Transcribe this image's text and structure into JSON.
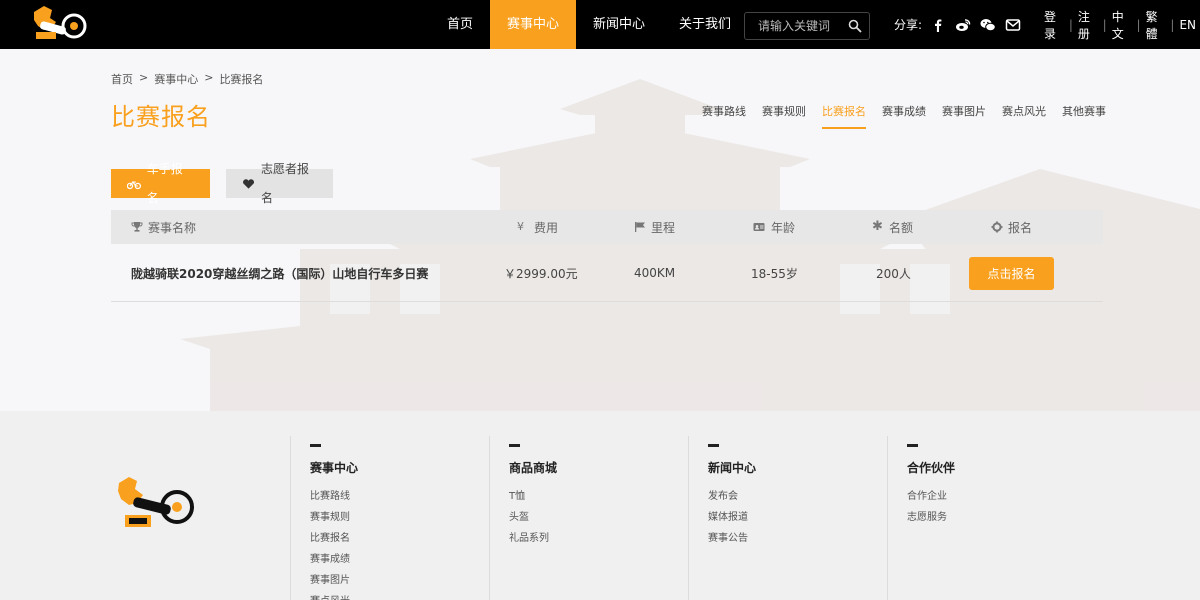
{
  "header": {
    "nav": [
      "首页",
      "赛事中心",
      "新闻中心",
      "关于我们"
    ],
    "nav_active": 1,
    "search_placeholder": "请输入关键词",
    "share_label": "分享:",
    "share_icons": [
      "facebook-icon",
      "weibo-icon",
      "wechat-icon",
      "email-icon"
    ],
    "links": [
      "登录",
      "注册",
      "中文",
      "繁體",
      "EN"
    ]
  },
  "breadcrumb": [
    "首页",
    ">",
    "赛事中心",
    ">",
    "比赛报名"
  ],
  "page_title": "比赛报名",
  "subnav": [
    "赛事路线",
    "赛事规则",
    "比赛报名",
    "赛事成绩",
    "赛事图片",
    "赛点风光",
    "其他赛事"
  ],
  "subnav_active": 2,
  "tabs": [
    {
      "label": "车手报名",
      "icon": "bicycle-icon"
    },
    {
      "label": "志愿者报名",
      "icon": "heart-icon"
    }
  ],
  "table": {
    "headers": [
      {
        "label": "赛事名称",
        "icon": "trophy-icon"
      },
      {
        "label": "费用",
        "icon": "yen-icon"
      },
      {
        "label": "里程",
        "icon": "flag-icon"
      },
      {
        "label": "年龄",
        "icon": "id-card-icon"
      },
      {
        "label": "名额",
        "icon": "asterisk-icon"
      },
      {
        "label": "报名",
        "icon": "gear-icon"
      }
    ],
    "rows": [
      {
        "name": "陇越骑联2020穿越丝绸之路（国际）山地自行车多日赛",
        "fee": "￥2999.00元",
        "distance": "400KM",
        "age": "18-55岁",
        "quota": "200人",
        "button": "点击报名"
      }
    ]
  },
  "footer": {
    "columns": [
      {
        "title": "赛事中心",
        "links": [
          "比赛路线",
          "赛事规则",
          "比赛报名",
          "赛事成绩",
          "赛事图片",
          "赛点风光"
        ]
      },
      {
        "title": "商品商城",
        "links": [
          "T恤",
          "头盔",
          "礼品系列"
        ]
      },
      {
        "title": "新闻中心",
        "links": [
          "发布会",
          "媒体报道",
          "赛事公告"
        ]
      },
      {
        "title": "合作伙伴",
        "links": [
          "合作企业",
          "志愿服务"
        ]
      }
    ]
  },
  "colors": {
    "accent": "#f9a01e",
    "topbar": "#000000",
    "footer": "#f0f0f0"
  }
}
